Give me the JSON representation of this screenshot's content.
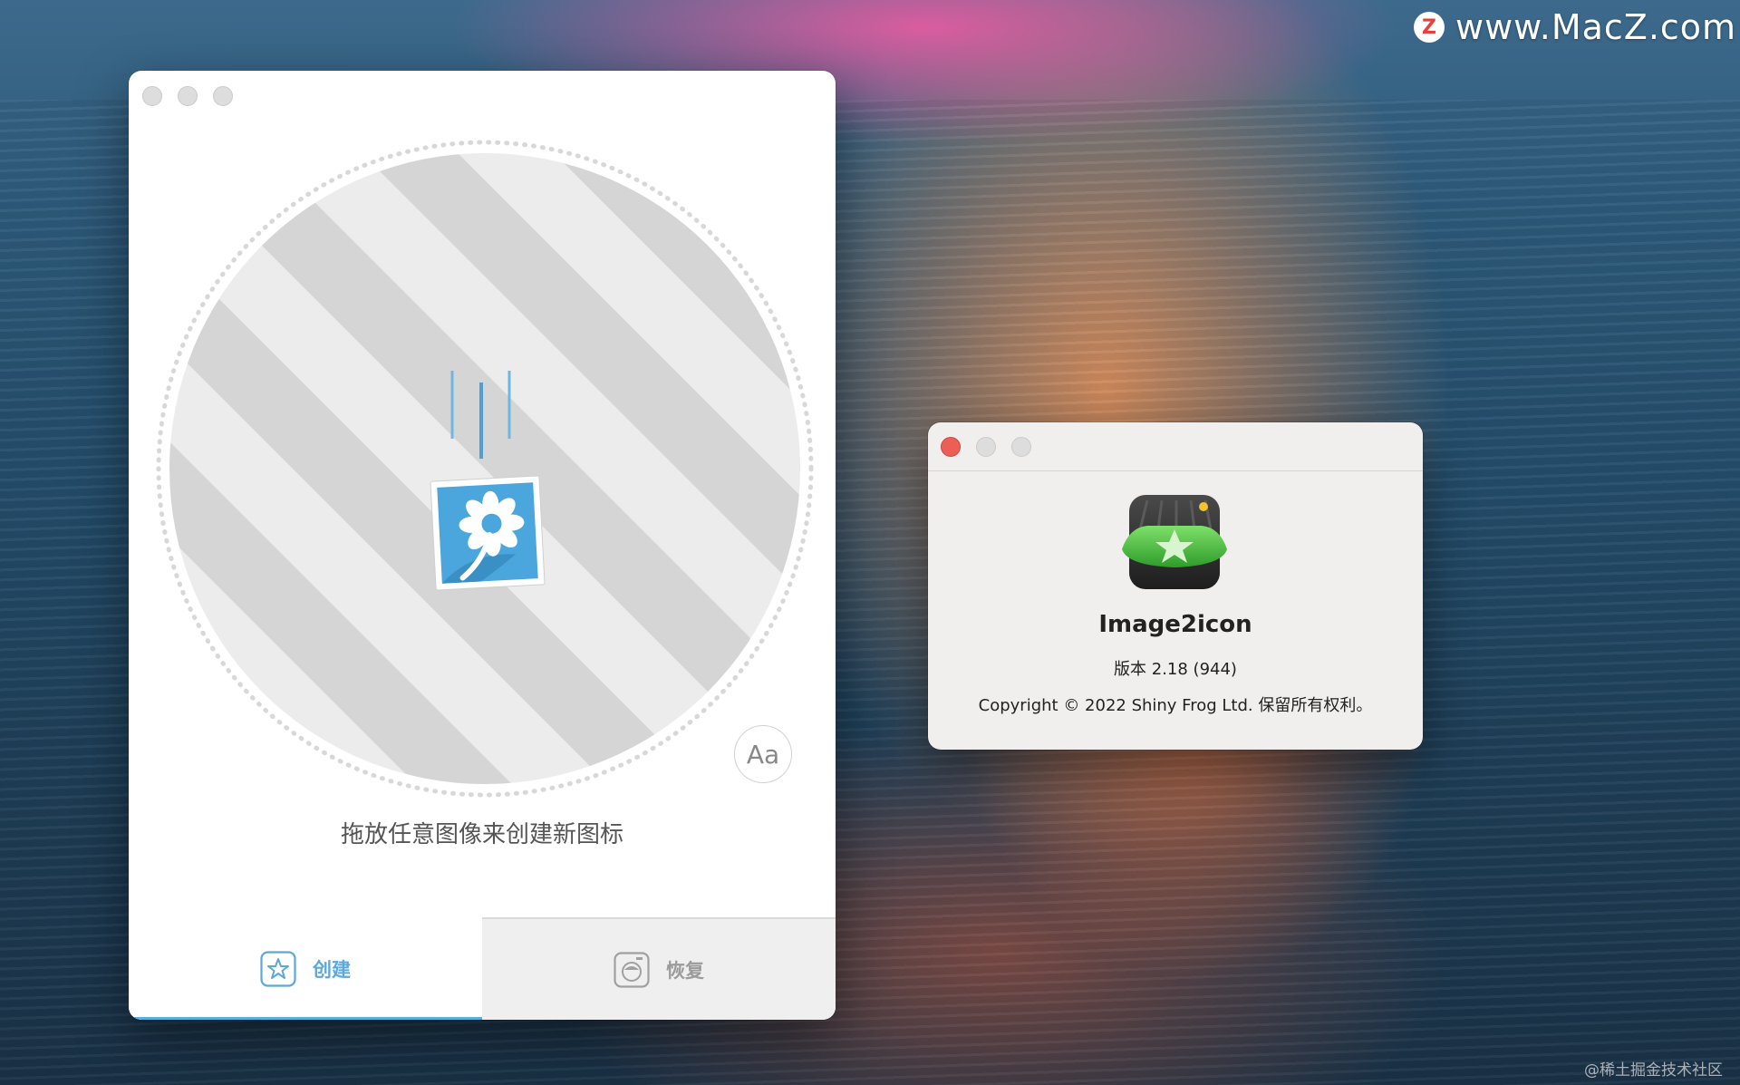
{
  "watermark": {
    "badge": "Z",
    "site": "www.MacZ.com",
    "footer": "@稀土掘金技术社区"
  },
  "main_window": {
    "drop_caption": "拖放任意图像来创建新图标",
    "font_button_label": "Aa",
    "tabs": [
      {
        "label": "创建",
        "icon": "star-icon",
        "selected": true
      },
      {
        "label": "恢复",
        "icon": "restore-icon",
        "selected": false
      }
    ],
    "drop_icon": "flower-image-icon"
  },
  "about_window": {
    "app_name": "Image2icon",
    "version": "版本 2.18 (944)",
    "copyright": "Copyright © 2022 Shiny Frog Ltd. 保留所有权利。",
    "app_icon": "image2icon-app-icon"
  },
  "colors": {
    "accent_blue": "#5aa9d8",
    "close_red": "#ec5f57",
    "app_icon_green": "#4cc23f"
  }
}
